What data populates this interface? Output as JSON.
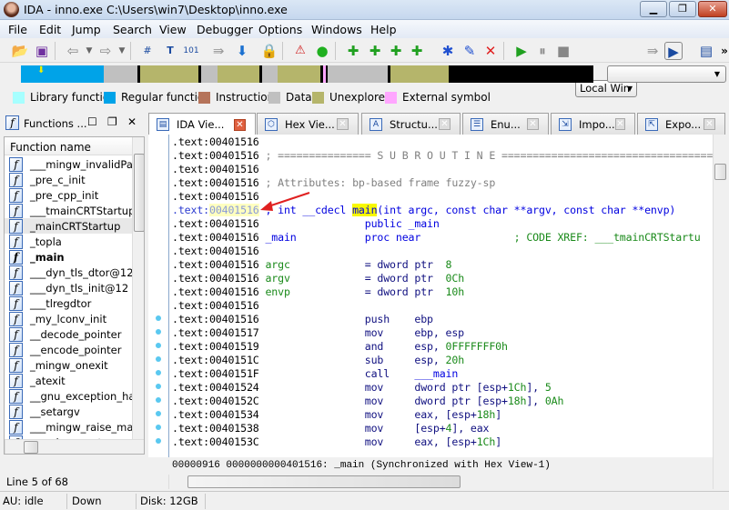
{
  "window": {
    "title": "IDA - inno.exe C:\\Users\\win7\\Desktop\\inno.exe",
    "minimize": "▁",
    "restore": "❐",
    "close": "✕"
  },
  "menu": [
    "File",
    "Edit",
    "Jump",
    "Search",
    "View",
    "Debugger",
    "Options",
    "Windows",
    "Help"
  ],
  "toolbar": {
    "debugger_select": "Local Win",
    "icons": [
      "open-icon",
      "save-icon",
      "back-icon",
      "forward-icon",
      "search-hex-icon",
      "search-text-icon",
      "search-binary-icon",
      "jump-icon",
      "down-arrow-icon",
      "lock-icon",
      "warning-icon",
      "green-circle-icon",
      "code-add-icon",
      "data-add-icon",
      "string-add-icon",
      "s-add-icon",
      "struct-add-icon",
      "edit-icon",
      "delete-icon",
      "run-icon",
      "pause-icon",
      "stop-icon",
      "step-icon",
      "pseudocode-icon",
      "info-icon"
    ],
    "more": "»"
  },
  "navband": {
    "colors": {
      "library": "#a6ffff",
      "regular": "#00a3e8",
      "instruction": "#b5735a",
      "data": "#c0c0c0",
      "unexplored": "#b5b56b",
      "external": "#ffa6ff",
      "black": "#000000"
    }
  },
  "legend": [
    {
      "label": "Library function",
      "color": "#a6ffff"
    },
    {
      "label": "Regular function",
      "color": "#00a3e8"
    },
    {
      "label": "Instruction",
      "color": "#b5735a"
    },
    {
      "label": "Data",
      "color": "#c0c0c0"
    },
    {
      "label": "Unexplored",
      "color": "#b5b56b"
    },
    {
      "label": "External symbol",
      "color": "#ffa6ff"
    }
  ],
  "functions_panel": {
    "title": "Functions ...",
    "column": "Function name",
    "items": [
      "___mingw_invalidParam",
      "_pre_c_init",
      "_pre_cpp_init",
      "___tmainCRTStartup",
      "_mainCRTStartup",
      "_topla",
      "_main",
      "___dyn_tls_dtor@12",
      "___dyn_tls_init@12",
      "___tlregdtor",
      "_my_lconv_init",
      "__decode_pointer",
      "__encode_pointer",
      "_mingw_onexit",
      "_atexit",
      "__gnu_exception_hand",
      "__setargv",
      "___mingw_raise_mathe",
      "___mingw_setusermath"
    ],
    "selected": "_mainCRTStartup",
    "bold": "_main",
    "line_status": "Line 5 of 68"
  },
  "tabs": [
    {
      "label": "IDA Vie...",
      "icon": "ida-view-icon",
      "active": true
    },
    {
      "label": "Hex Vie...",
      "icon": "hex-view-icon"
    },
    {
      "label": "Structu...",
      "icon": "structures-icon"
    },
    {
      "label": "Enu...",
      "icon": "enums-icon"
    },
    {
      "label": "Impo...",
      "icon": "imports-icon"
    },
    {
      "label": "Expo...",
      "icon": "exports-icon"
    }
  ],
  "code": [
    {
      "addr": ".text:00401516",
      "parts": []
    },
    {
      "addr": ".text:00401516",
      "parts": [
        {
          "t": " ; =============== S U B R O U T I N E =======================================",
          "k": "c"
        }
      ]
    },
    {
      "addr": ".text:00401516",
      "parts": []
    },
    {
      "addr": ".text:00401516",
      "parts": [
        {
          "t": " ; Attributes: bp-based frame fuzzy-sp",
          "k": "c"
        }
      ]
    },
    {
      "addr": ".text:00401516",
      "parts": []
    },
    {
      "addr": ".text:00401516",
      "cur": true,
      "parts": [
        {
          "t": " ; int __cdecl ",
          "k": "b"
        },
        {
          "t": "main",
          "k": "hl"
        },
        {
          "t": "(int argc, const char **argv, const char **envp)",
          "k": "b"
        }
      ]
    },
    {
      "addr": ".text:00401516",
      "parts": [
        {
          "t": "                 public _main",
          "k": "b"
        }
      ]
    },
    {
      "addr": ".text:00401516",
      "parts": [
        {
          "t": " _main           proc near               ",
          "k": "b"
        },
        {
          "t": "; CODE XREF: ___tmainCRTStartu",
          "k": "g"
        }
      ]
    },
    {
      "addr": ".text:00401516",
      "parts": []
    },
    {
      "addr": ".text:00401516",
      "parts": [
        {
          "t": " argc",
          "k": "g"
        },
        {
          "t": "            = dword ptr  ",
          "k": "n"
        },
        {
          "t": "8",
          "k": "g"
        }
      ]
    },
    {
      "addr": ".text:00401516",
      "parts": [
        {
          "t": " argv",
          "k": "g"
        },
        {
          "t": "            = dword ptr  ",
          "k": "n"
        },
        {
          "t": "0Ch",
          "k": "g"
        }
      ]
    },
    {
      "addr": ".text:00401516",
      "parts": [
        {
          "t": " envp",
          "k": "g"
        },
        {
          "t": "            = dword ptr  ",
          "k": "n"
        },
        {
          "t": "10h",
          "k": "g"
        }
      ]
    },
    {
      "addr": ".text:00401516",
      "parts": []
    },
    {
      "addr": ".text:00401516",
      "dot": true,
      "parts": [
        {
          "t": "                 push    ebp",
          "k": "n"
        }
      ]
    },
    {
      "addr": ".text:00401517",
      "dot": true,
      "parts": [
        {
          "t": "                 mov     ebp, esp",
          "k": "n"
        }
      ]
    },
    {
      "addr": ".text:00401519",
      "dot": true,
      "parts": [
        {
          "t": "                 and     esp, ",
          "k": "n"
        },
        {
          "t": "0FFFFFFF0h",
          "k": "g"
        }
      ]
    },
    {
      "addr": ".text:0040151C",
      "dot": true,
      "parts": [
        {
          "t": "                 sub     esp, ",
          "k": "n"
        },
        {
          "t": "20h",
          "k": "g"
        }
      ]
    },
    {
      "addr": ".text:0040151F",
      "dot": true,
      "parts": [
        {
          "t": "                 call    ",
          "k": "n"
        },
        {
          "t": "___main",
          "k": "b"
        }
      ]
    },
    {
      "addr": ".text:00401524",
      "dot": true,
      "parts": [
        {
          "t": "                 mov     dword ptr [esp+",
          "k": "n"
        },
        {
          "t": "1Ch",
          "k": "g"
        },
        {
          "t": "], ",
          "k": "n"
        },
        {
          "t": "5",
          "k": "g"
        }
      ]
    },
    {
      "addr": ".text:0040152C",
      "dot": true,
      "parts": [
        {
          "t": "                 mov     dword ptr [esp+",
          "k": "n"
        },
        {
          "t": "18h",
          "k": "g"
        },
        {
          "t": "], ",
          "k": "n"
        },
        {
          "t": "0Ah",
          "k": "g"
        }
      ]
    },
    {
      "addr": ".text:00401534",
      "dot": true,
      "parts": [
        {
          "t": "                 mov     eax, [esp+",
          "k": "n"
        },
        {
          "t": "18h",
          "k": "g"
        },
        {
          "t": "]",
          "k": "n"
        }
      ]
    },
    {
      "addr": ".text:00401538",
      "dot": true,
      "parts": [
        {
          "t": "                 mov     [esp+",
          "k": "n"
        },
        {
          "t": "4",
          "k": "g"
        },
        {
          "t": "], eax",
          "k": "n"
        }
      ]
    },
    {
      "addr": ".text:0040153C",
      "dot": true,
      "parts": [
        {
          "t": "                 mov     eax, [esp+",
          "k": "n"
        },
        {
          "t": "1Ch",
          "k": "g"
        },
        {
          "t": "]",
          "k": "n"
        }
      ]
    }
  ],
  "code_status": {
    "offset": "00000916",
    "location": "0000000000401516: _main (Synchronized with Hex View-1)"
  },
  "statusbar": {
    "au": "AU:  idle",
    "direction": "Down",
    "disk": "Disk: 12GB"
  }
}
